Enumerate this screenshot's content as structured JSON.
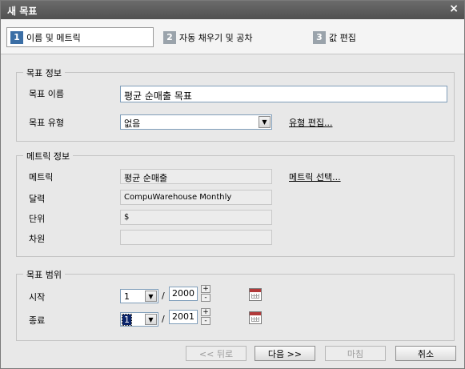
{
  "window": {
    "title": "새 목표",
    "close_glyph": "×"
  },
  "steps": [
    {
      "num": "1",
      "label": "이름 및 메트릭"
    },
    {
      "num": "2",
      "label": "자동 채우기 및 공차"
    },
    {
      "num": "3",
      "label": "값 편집"
    }
  ],
  "goal_info": {
    "legend": "목표 정보",
    "name_label": "목표 이름",
    "name_value": "평균 순매출 목표",
    "type_label": "목표 유형",
    "type_value": "없음",
    "edit_type_link": "유형 편집..."
  },
  "metric_info": {
    "legend": "메트릭 정보",
    "metric_label": "메트릭",
    "metric_value": "평균 순매출",
    "select_metric_link": "메트릭 선택...",
    "calendar_label": "달력",
    "calendar_value": "CompuWarehouse Monthly",
    "unit_label": "단위",
    "unit_value": "$",
    "dimension_label": "차원",
    "dimension_value": ""
  },
  "goal_range": {
    "legend": "목표 범위",
    "start_label": "시작",
    "start_period": "1",
    "start_year": "2000",
    "end_label": "종료",
    "end_period": "1",
    "end_year": "2001",
    "separator": "/",
    "spin_up": "+",
    "spin_down": "-"
  },
  "footer": {
    "back": "<< 뒤로",
    "next": "다음 >>",
    "finish": "마침",
    "cancel": "취소"
  }
}
